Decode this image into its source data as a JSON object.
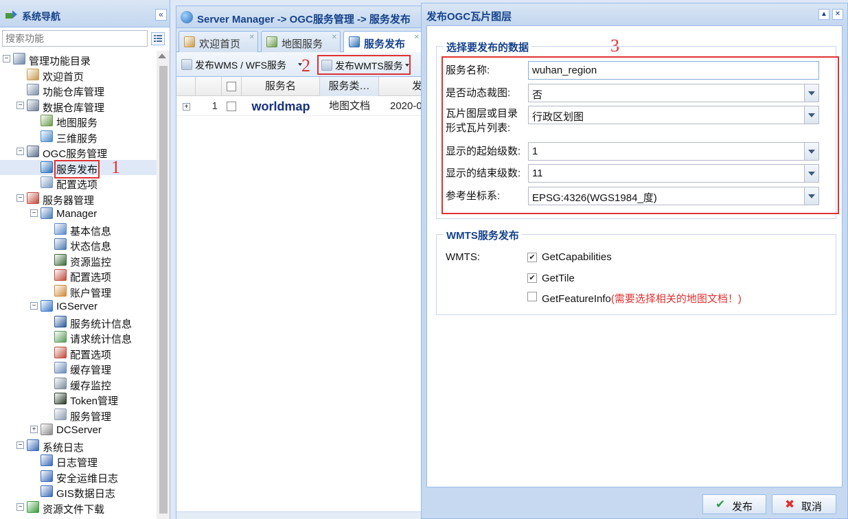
{
  "nav": {
    "title": "系统导航",
    "collapse_glyph": "«",
    "search_placeholder": "搜索功能",
    "tree": [
      {
        "label": "管理功能目录",
        "level": 0,
        "toggle": "−",
        "icon": "monitor-gear-icon",
        "color": "#6c87a8"
      },
      {
        "label": "欢迎首页",
        "level": 1,
        "icon": "house-icon",
        "color": "#c79a4b"
      },
      {
        "label": "功能仓库管理",
        "level": 1,
        "icon": "key-icon",
        "color": "#7d8ea6"
      },
      {
        "label": "数据仓库管理",
        "level": 1,
        "toggle": "−",
        "icon": "database-icon",
        "color": "#6f7f95"
      },
      {
        "label": "地图服务",
        "level": 2,
        "icon": "map-icon",
        "color": "#6a9a4a"
      },
      {
        "label": "三维服务",
        "level": 2,
        "icon": "globe-icon",
        "color": "#4a8cc8"
      },
      {
        "label": "OGC服务管理",
        "level": 1,
        "toggle": "−",
        "icon": "ogc-icon",
        "color": "#5c6e8a"
      },
      {
        "label": "服务发布",
        "level": 2,
        "icon": "publish-globe-icon",
        "color": "#2d6fb8",
        "selected": true
      },
      {
        "label": "配置选项",
        "level": 2,
        "icon": "settings-icon",
        "color": "#7a99c0"
      },
      {
        "label": "服务器管理",
        "level": 1,
        "toggle": "−",
        "icon": "server-tools-icon",
        "color": "#c04a3a"
      },
      {
        "label": "Manager",
        "level": 2,
        "toggle": "−",
        "icon": "user-icon",
        "color": "#4a7ab8"
      },
      {
        "label": "基本信息",
        "level": 3,
        "icon": "info-card-icon",
        "color": "#5a88c8"
      },
      {
        "label": "状态信息",
        "level": 3,
        "icon": "status-icon",
        "color": "#4a78b0"
      },
      {
        "label": "资源监控",
        "level": 3,
        "icon": "monitor-icon",
        "color": "#3a6a3a"
      },
      {
        "label": "配置选项",
        "level": 3,
        "icon": "tools-icon",
        "color": "#c04a3a"
      },
      {
        "label": "账户管理",
        "level": 3,
        "icon": "users-icon",
        "color": "#d08a3a"
      },
      {
        "label": "IGServer",
        "level": 2,
        "toggle": "−",
        "icon": "globe-server-icon",
        "color": "#3a7ac8"
      },
      {
        "label": "服务统计信息",
        "level": 3,
        "icon": "screen-icon",
        "color": "#2a5a9a"
      },
      {
        "label": "请求统计信息",
        "level": 3,
        "icon": "globe-icon",
        "color": "#5a9a5a"
      },
      {
        "label": "配置选项",
        "level": 3,
        "icon": "tools-icon",
        "color": "#c04a3a"
      },
      {
        "label": "缓存管理",
        "level": 3,
        "icon": "cache-icon",
        "color": "#6a8ab8"
      },
      {
        "label": "缓存监控",
        "level": 3,
        "icon": "chart-icon",
        "color": "#7a8a9a"
      },
      {
        "label": "Token管理",
        "level": 3,
        "icon": "token-icon",
        "color": "#2a3a2a"
      },
      {
        "label": "服务管理",
        "level": 3,
        "icon": "magnifier-icon",
        "color": "#8a9ab0"
      },
      {
        "label": "DCServer",
        "level": 2,
        "toggle": "+",
        "icon": "server-icon",
        "color": "#8a8a8a"
      },
      {
        "label": "系统日志",
        "level": 1,
        "toggle": "−",
        "icon": "book-icon",
        "color": "#3a6ab8"
      },
      {
        "label": "日志管理",
        "level": 2,
        "icon": "book-icon",
        "color": "#3a6ab8"
      },
      {
        "label": "安全运维日志",
        "level": 2,
        "icon": "book-icon",
        "color": "#3a6ab8"
      },
      {
        "label": "GIS数据日志",
        "level": 2,
        "icon": "book-icon",
        "color": "#3a6ab8"
      },
      {
        "label": "资源文件下载",
        "level": 1,
        "toggle": "−",
        "icon": "download-icon",
        "color": "#3a9a3a"
      }
    ]
  },
  "main": {
    "title": "Server Manager -> OGC服务管理 -> 服务发布",
    "tabs": [
      {
        "label": "欢迎首页",
        "icon": "house-icon",
        "color": "#c79a4b"
      },
      {
        "label": "地图服务",
        "icon": "map-icon",
        "color": "#6a9a4a"
      },
      {
        "label": "服务发布",
        "icon": "publish-globe-icon",
        "color": "#2d6fb8",
        "active": true
      }
    ],
    "toolbar": {
      "wms_wfs": "发布WMS / WFS服务",
      "wmts": "发布WMTS服务"
    },
    "grid": {
      "columns": [
        "服务名",
        "服务类…",
        "发"
      ],
      "rows": [
        {
          "index": "1",
          "name": "worldmap",
          "type": "地图文档",
          "date": "2020-0"
        }
      ]
    }
  },
  "annotations": [
    "1",
    "2",
    "3"
  ],
  "dialog": {
    "title": "发布OGC瓦片图层",
    "section1": {
      "legend": "选择要发布的数据",
      "fields": [
        {
          "label": "服务名称:",
          "value": "wuhan_region",
          "kind": "text"
        },
        {
          "label": "是否动态裁图:",
          "value": "否",
          "kind": "combo"
        },
        {
          "label": "瓦片图层或目录形式瓦片列表:",
          "label_lines": [
            "瓦片图层或目录",
            "形式瓦片列表:"
          ],
          "value": "行政区划图",
          "kind": "combo"
        },
        {
          "label": "显示的起始级数:",
          "value": "1",
          "kind": "combo"
        },
        {
          "label": "显示的结束级数:",
          "value": "11",
          "kind": "combo"
        },
        {
          "label": "参考坐标系:",
          "value": "EPSG:4326(WGS1984_度)",
          "kind": "combo"
        }
      ]
    },
    "section2": {
      "legend": "WMTS服务发布",
      "label": "WMTS:",
      "options": [
        {
          "label": "GetCapabilities",
          "checked": true
        },
        {
          "label": "GetTile",
          "checked": true
        },
        {
          "label": "GetFeatureInfo",
          "checked": false,
          "note": "(需要选择相关的地图文档！)"
        }
      ]
    },
    "buttons": {
      "publish": "发布",
      "cancel": "取消"
    }
  },
  "colors": {
    "annotation_red": "#e03131",
    "header_blue": "#15428b",
    "publish_check": "#2f9e44",
    "cancel_x": "#e03131"
  }
}
